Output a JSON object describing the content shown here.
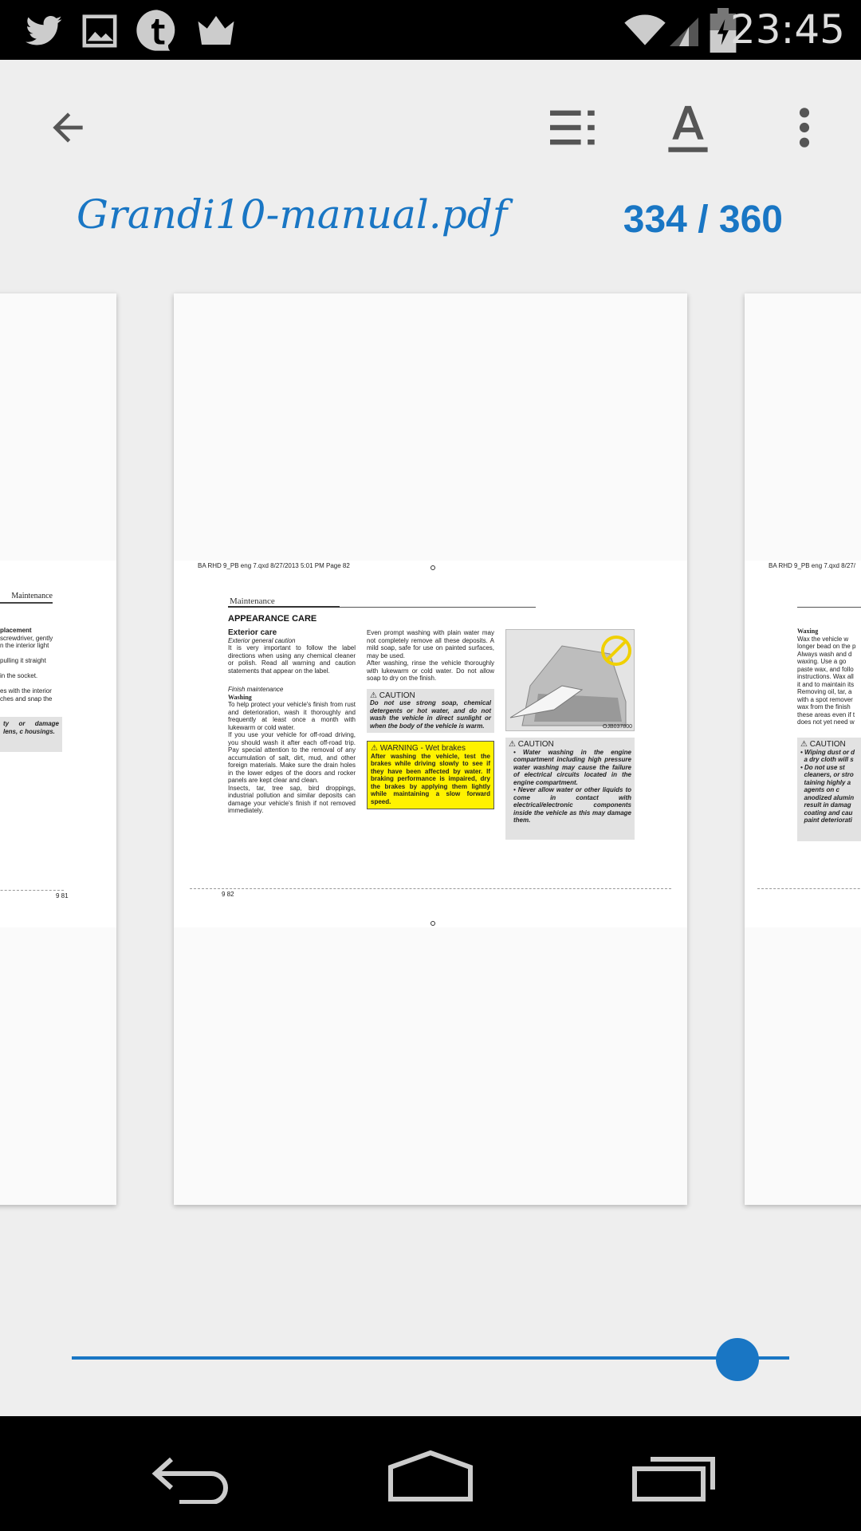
{
  "status_bar": {
    "time": "23:45",
    "notification_icons": [
      "twitter-icon",
      "image-icon",
      "tumblr-icon",
      "crown-icon"
    ],
    "system_icons": [
      "wifi-icon",
      "cell-signal-icon",
      "battery-charging-icon"
    ]
  },
  "toolbar": {
    "icons": [
      "back-arrow-icon",
      "toc-list-icon",
      "text-format-icon",
      "overflow-menu-icon"
    ]
  },
  "document": {
    "title": "Grandi10-manual.pdf",
    "current_page": "334",
    "separator": "/",
    "total_pages": "360",
    "progress": 0.928
  },
  "pages": {
    "left": {
      "section": "Maintenance",
      "heading": "placement",
      "lines": [
        "screwdriver, gently",
        "n the interior light",
        "pulling it straight",
        "in the socket.",
        "es with the interior",
        "ches and snap the"
      ],
      "caution": "ty or damage lens, c housings.",
      "footer": "9 81"
    },
    "center": {
      "header": "BA RHD 9_PB eng 7.qxd 8/27/2013 5:01 PM Page 82",
      "section": "Maintenance",
      "heading": "APPEARANCE CARE",
      "col1": {
        "subheading": "Exterior care",
        "sub1": "Exterior general caution",
        "p1": "It is very important to follow the label directions when using any chemical cleaner or polish. Read all warning and caution statements that appear on the label.",
        "sub2": "Finish maintenance",
        "sub3": "Washing",
        "p2": "To help protect your vehicle's finish from rust and deterioration, wash it thoroughly and frequently at least once a month with lukewarm or cold water.",
        "p3": "If you use your vehicle for off-road driving, you should wash it after each off-road trip. Pay special attention to the removal of any accumulation of salt, dirt, mud, and other foreign materials. Make sure the drain holes in the lower edges of the doors and rocker panels are kept clear and clean.",
        "p4": "Insects, tar, tree sap, bird droppings, industrial pollution and similar deposits can damage your vehicle's finish if not removed immediately."
      },
      "col2": {
        "p1": "Even prompt washing with plain water may not completely remove all these deposits. A mild soap, safe for use on painted surfaces, may be used.",
        "p2": "After washing, rinse the vehicle thoroughly with lukewarm or cold water. Do not allow soap to dry on the finish.",
        "caution_title": "CAUTION",
        "caution_text": "Do not use strong soap, chemical detergents or hot water, and do not wash the vehicle in direct sunlight or when the body of the vehicle is warm.",
        "warning_title": "WARNING - Wet brakes",
        "warning_text": "After washing the vehicle, test the brakes while driving slowly to see if they have been affected by water. If braking performance is impaired, dry the brakes by applying them lightly while maintaining a slow forward speed."
      },
      "col3": {
        "image_code": "OJB037800",
        "caution_title": "CAUTION",
        "bullet1": "Water washing in the engine compartment including high pressure water washing may cause the failure of electrical circuits located in the engine compartment.",
        "bullet2": "Never allow water or other liquids to come in contact with electrical/electronic components inside the vehicle as this may damage them."
      },
      "footer": "9 82"
    },
    "right": {
      "header": "BA RHD 9_PB eng 7.qxd 8/27/",
      "heading": "Waxing",
      "lines": [
        "Wax the vehicle w",
        "longer bead on the p",
        "Always wash and d",
        "waxing. Use a go",
        "paste wax, and follo",
        "instructions. Wax all",
        "it and to maintain its",
        "Removing oil, tar, a",
        "with a spot remover",
        "wax from the finish",
        "these areas even if t",
        "does not yet need w"
      ],
      "caution_title": "CAUTION",
      "caution_lines": [
        "Wiping dust or d",
        "a dry cloth will s",
        "Do not use st",
        "cleaners, or stro",
        "taining highly a",
        "agents on c",
        "anodized alumin",
        "result in damag",
        "coating and cau",
        "paint deteriorati"
      ]
    }
  },
  "nav_bar": {
    "icons": [
      "back-nav-icon",
      "home-nav-icon",
      "recents-nav-icon"
    ]
  }
}
